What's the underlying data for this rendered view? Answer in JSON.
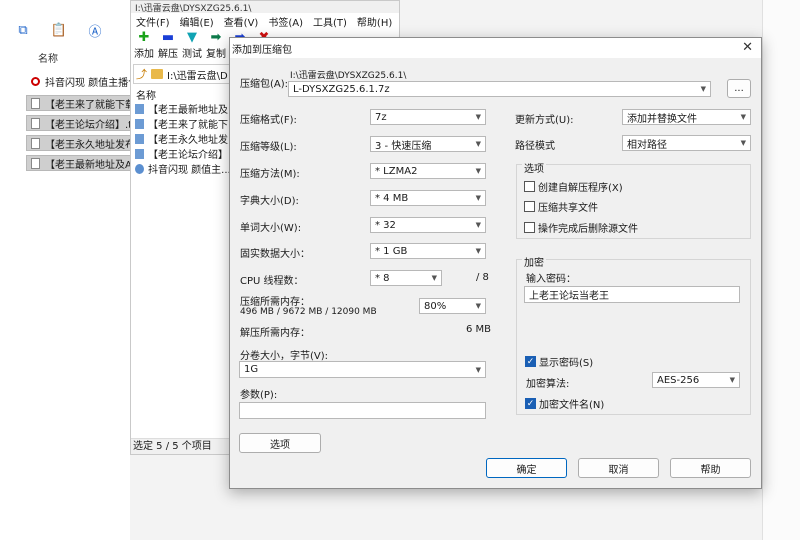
{
  "explorer": {
    "column_name": "名称",
    "files": [
      {
        "name": "抖音闪现 颜值主播合",
        "icon": "red-circle-icon",
        "selected": false
      },
      {
        "name": "【老王来了就能下载",
        "icon": "doc-icon",
        "selected": true
      },
      {
        "name": "【老王论坛介绍】.tx",
        "icon": "doc-icon",
        "selected": true
      },
      {
        "name": "【老王永久地址发布",
        "icon": "doc-icon",
        "selected": true
      },
      {
        "name": "【老王最新地址及A",
        "icon": "doc-icon",
        "selected": true
      }
    ]
  },
  "zip": {
    "title": "I:\\迅雷云盘\\DYSXZG25.6.1\\",
    "menu": [
      "文件(F)",
      "编辑(E)",
      "查看(V)",
      "书签(A)",
      "工具(T)",
      "帮助(H)"
    ],
    "toolbar": [
      {
        "label": "添加",
        "icon": "plus-icon",
        "color": "#1aa31a"
      },
      {
        "label": "解压",
        "icon": "minus-icon",
        "color": "#1a3fd6"
      },
      {
        "label": "测试",
        "icon": "check-icon",
        "color": "#11a3b3"
      },
      {
        "label": "复制",
        "icon": "arrow-right-icon",
        "color": "#0d7a4a"
      },
      {
        "label": "",
        "icon": "move-icon",
        "color": "#1a3fd6"
      },
      {
        "label": "",
        "icon": "delete-icon",
        "color": "#d01010"
      }
    ],
    "address": "I:\\迅雷云盘\\D",
    "column_name": "名称",
    "files": [
      "【老王最新地址及..",
      "【老王来了就能下..",
      "【老王永久地址发..",
      "【老王论坛介绍】..",
      "抖音闪现 颜值主..."
    ],
    "status": "选定 5 / 5 个项目"
  },
  "dialog": {
    "title": "添加到压缩包",
    "archive_label": "压缩包(A):",
    "archive_path": "I:\\迅雷云盘\\DYSXZG25.6.1\\",
    "archive_name": "L-DYSXZG25.6.1.7z",
    "browse_label": "...",
    "format_label": "压缩格式(F):",
    "format_value": "7z",
    "level_label": "压缩等级(L):",
    "level_value": "3 - 快速压缩",
    "method_label": "压缩方法(M):",
    "method_value": "* LZMA2",
    "dict_label": "字典大小(D):",
    "dict_value": "* 4 MB",
    "word_label": "单词大小(W):",
    "word_value": "* 32",
    "solid_label": "固实数据大小：",
    "solid_value": "* 1 GB",
    "cpu_label": "CPU 线程数：",
    "cpu_value": "* 8",
    "cpu_total": "/ 8",
    "mem_compress_label": "压缩所需内存：",
    "mem_compress_detail": "496 MB / 9672 MB / 12090 MB",
    "mem_percent": "80%",
    "mem_decompress_label": "解压所需内存：",
    "mem_decompress_value": "6 MB",
    "volume_label": "分卷大小，字节(V):",
    "volume_value": "1G",
    "params_label": "参数(P):",
    "params_value": "",
    "options_button": "选项",
    "update_label": "更新方式(U):",
    "update_value": "添加并替换文件",
    "path_label": "路径模式",
    "path_value": "相对路径",
    "options_group": "选项",
    "opt_sfx": "创建自解压程序(X)",
    "opt_shared": "压缩共享文件",
    "opt_delete": "操作完成后删除源文件",
    "encrypt_group": "加密",
    "password_label": "输入密码：",
    "password_value": "上老王论坛当老王",
    "show_password": "显示密码(S)",
    "method_enc_label": "加密算法:",
    "method_enc_value": "AES-256",
    "encrypt_names": "加密文件名(N)",
    "ok": "确定",
    "cancel": "取消",
    "help": "帮助"
  }
}
